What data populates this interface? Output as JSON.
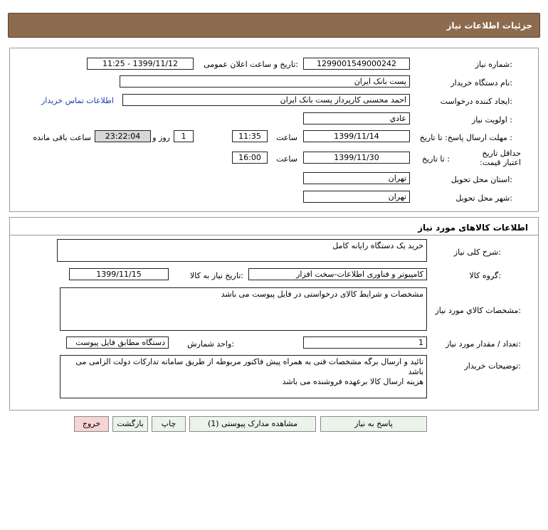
{
  "header": {
    "title": "جزئیات اطلاعات نیاز"
  },
  "details": {
    "need_number_label": "شماره نیاز:",
    "need_number": "1299001549000242",
    "announce_label": "تاریخ و ساعت اعلان عمومی:",
    "announce_value": "1399/11/12 - 11:25",
    "buyer_org_label": "نام دستگاه خریدار:",
    "buyer_org": "پست بانک ایران",
    "creator_label": "ایجاد کننده درخواست:",
    "creator": "احمد  محسنی کارپرداز پست بانک ایران",
    "contact_link": "اطلاعات تماس خریدار",
    "priority_label": "اولویت نیاز :",
    "priority": "عادي",
    "deadline_label": "مهلت ارسال پاسخ: تا تاریخ :",
    "deadline_date": "1399/11/14",
    "time_label": "ساعت",
    "deadline_time": "11:35",
    "days_value": "1",
    "days_label": "روز و",
    "remaining_time": "23:22:04",
    "remaining_label": "ساعت باقی مانده",
    "validity_label": "حداقل تاریخ اعتبار قیمت:",
    "validity_to_label": "تا تاریخ :",
    "validity_date": "1399/11/30",
    "validity_time_label": "ساعت",
    "validity_time": "16:00",
    "province_label": "استان محل تحویل:",
    "province": "تهران",
    "city_label": "شهر محل تحویل:",
    "city": "تهران"
  },
  "goods": {
    "section_title": "اطلاعات کالاهای مورد نیاز",
    "summary_label": "شرح کلی نیاز:",
    "summary": "خرید یک دستگاه رایانه کامل",
    "group_label": "گروه کالا:",
    "group": "کامپیوتر و فناوری اطلاعات-سخت افزار",
    "need_date_label": "تاریخ نیاز به کالا:",
    "need_date": "1399/11/15",
    "spec_label": "مشخصات کالاي مورد نیاز:",
    "spec": "مشخصات و شرایط کالای درخواستی در فایل پیوست می باشد",
    "qty_label": "تعداد / مقدار مورد نیاز:",
    "qty": "1",
    "unit_label": "واحد شمارش:",
    "unit": "دستگاه مطابق فایل پیوست",
    "notes_label": "توضیحات خریدار:",
    "notes_line1": "تائید و ارسال برگه مشخصات فنی به همراه پیش فاکتور مربوطه از طریق سامانه تدارکات دولت الزامی می باشد",
    "notes_line2": "هزینه ارسال کالا برعهده فروشنده می باشد"
  },
  "buttons": {
    "reply": "پاسخ به نیاز",
    "attachments": "مشاهده مدارک پیوستی (1)",
    "print": "چاپ",
    "back": "بازگشت",
    "exit": "خروج"
  }
}
